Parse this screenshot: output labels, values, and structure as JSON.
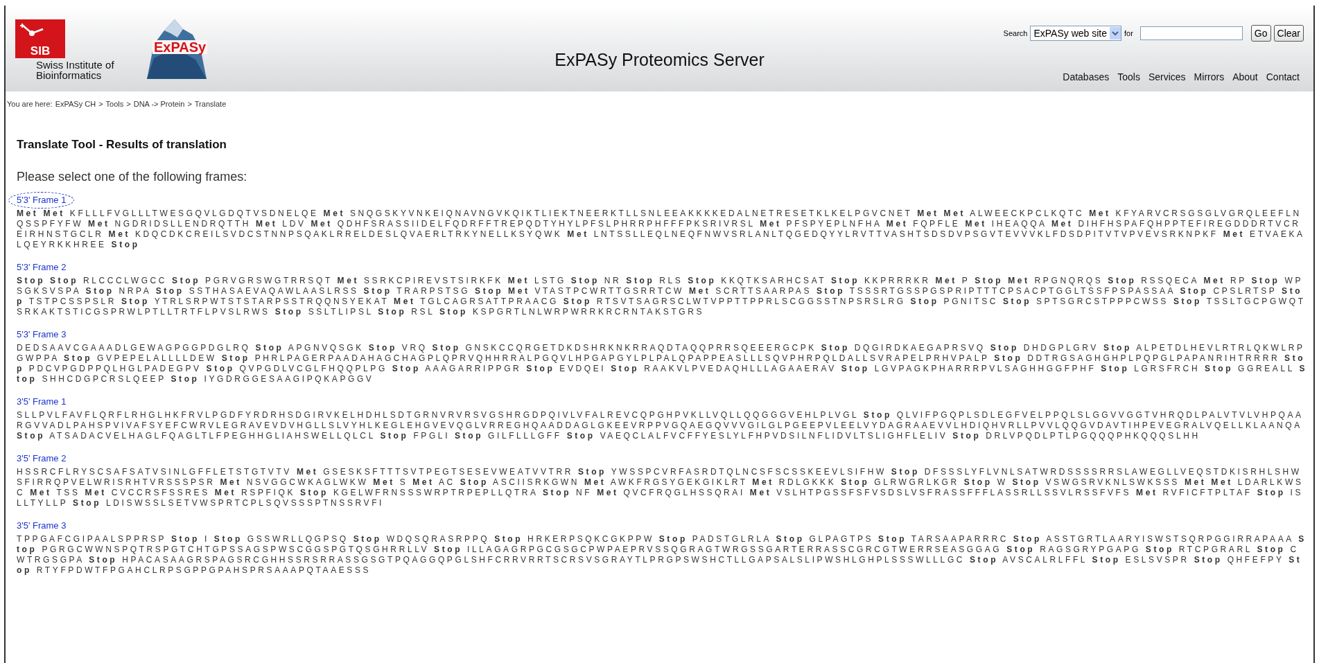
{
  "header": {
    "sib_logo_text": "SIB",
    "institute_name": "Swiss Institute of Bioinformatics",
    "expasy_logo_text": "ExPASy",
    "title": "ExPASy Proteomics Server",
    "search": {
      "label": "Search",
      "scope": "ExPASy web site",
      "for_label": "for",
      "buttons": [
        "Go",
        "Clear"
      ]
    },
    "nav": [
      "Databases",
      "Tools",
      "Services",
      "Mirrors",
      "About",
      "Contact"
    ]
  },
  "breadcrumb": {
    "prefix": "You are here:",
    "separator": ">",
    "items": [
      "ExPASy CH",
      "Tools",
      "DNA -> Protein",
      "Translate"
    ]
  },
  "heading": "Translate Tool - Results of translation",
  "instruction": "Please select one of the following frames:",
  "frames": [
    {
      "title": "5'3' Frame 1",
      "highlighted": true,
      "sequence": "**Met** **Met** KFLLLFVGLLLTWESGQVLGDQTVSDNELQE **Met** SNQGSKYVNKEIQNAVNGVKQIKTLIEKTNEERKTLLSNLEEAKKKKEDALNETRESETKLKELPGVCNET **Met** **Met** ALWEECKPCLKQTC **Met** KFYARVCRSGSGLVGRQLEEFLNQSSPFYFW **Met** NGDRIDSLLENDRQTTH **Met** LDV **Met** QDHFSRASSIIDELFQDRFFTREPQDTYHYLPFSLPHRRPHFFFPKSRIVRSL **Met** PFSPYEPLNFHA **Met** FQPFLE **Met** IHEAQQA **Met** DIHFHSPAFQHPPTEFIREGDDDRTVCREIRHNSTGCLR **Met** KDQCDKCREILSVDCSTNNPSQAKLRRELDESLQVAERLTRKYNELLKSYQWK **Met** LNTSSLLEQLNEQFNWVSRLANLTQGEDQYYLRVTTVASHTSDSDVPSGVTEVVVKLFDSDPITVTVPVEVSRKNPKF **Met** ETVAEKALQEYRKKHREE **Stop**"
    },
    {
      "title": "5'3' Frame 2",
      "highlighted": false,
      "sequence": "**Stop** **Stop** RLCCCLWGCC **Stop** PGRVGRSWGTRRSQT **Met** SSRKCPIREVSTSIRKFK **Met** LSTG **Stop** NR **Stop** RLS **Stop** KKQTKSARHCSAT **Stop** KKPRRRKR **Met** P **Stop** **Met** RPGNQRQS **Stop** RSSQECA **Met** RP **Stop** WPSGKSVSPA **Stop** NRPA **Stop** SSTHASAEVAQAWLAASLRSS **Stop** TRARPSTSG **Stop** **Met** VTASTPCWRTTGSRRTCW **Met** SCRTTSAARPAS **Stop** TSSSRTGSSPGSPRIPTTTCPSACPTGGLTSSFPSPASSAA **Stop** CPSLRTSP **Stop** TSTPCSSPSLR **Stop** YTRLSRPWTSTSTARPSSTRQQNSYEKAT **Met** TGLCAGRSATTPRAACG **Stop** RTSVTSAGRSCLWTVPPTTPPRLSCGGSSTNPSRSLRG **Stop** PGNITSC **Stop** SPTSGRCSTPPPCWSS **Stop** TSSLTGCPGWQTSRKAKTSTICGSPRWLPTLLTRTFLPVSLRWS **Stop** SSLTLIPSL **Stop** RSL **Stop** KSPGRTLNLWRPWRRKRCRNTAKSTGRS"
    },
    {
      "title": "5'3' Frame 3",
      "highlighted": false,
      "sequence": "DEDSAAVCGAAADLGEWAGPGGPDGLRQ **Stop** APGNVQSGK **Stop** VRQ **Stop** GNSKCCQRGETDKDSHRKNKRRAQDTAQQPRRSQEEERGCPK **Stop** DQGIRDKAEGAPRSVQ **Stop** DHDGPLGRV **Stop** ALPETDLHEVLRTRLQKWLRPGWPPA **Stop** GVPEPELALLLLDEW **Stop** PHRLPAGERPAADAHAGCHAGPLQPRVQHHRRALPGQVLHPGAPGYLPLPALQPAPPEASLLLSQVPHRPQLDALLSVRAPELPRHVPALP **Stop** DDTRGSAGHGHPLPQPGLPAPANRIHTRRRR **Stop** PDCVPGDPPQLHGLPADEGPV **Stop** QVPGDLVCGLFHQQPLPG **Stop** AAAGARRIPPGR **Stop** EVDQEI **Stop** RAAKVLPVEDAQHLLLAGAAERAV **Stop** LGVPAGKPHARRRPVLSAGHHGGFPHF **Stop** LGRSFRCH **Stop** GGREALL **Stop** SHHCDGPCRSLQEEP **Stop** IYGDRGGESAAGIPQKAPGGV"
    },
    {
      "title": "3'5' Frame 1",
      "highlighted": false,
      "sequence": "SLLPVLFAVFLQRFLRHGLHKFRVLPGDFYRDRHSDGIRVKELHDHLSDTGRNVRVRSVGSHRGDPQIVLVFALREVCQPGHPVKLLVQLLQQGGGVEHLPLVGL **Stop** QLVIFPGQPLSDLEGFVELPPQLSLGGVVGGTVHRQDLPALVTVLVHPQAARGVVADLPAHSPVIVAFSYEFCWRVLEGRAVEVDVHGLLSLVYHLKEGLEHGVEVQGLVRREGHQAADDAGLGKEEVRPPVGQAEGQVVVGILGLPGEEPVLEELVYDAGRAAEVVLHDIQHVRLLPVVLQQGVDAVTIHPEVEGRALVQELLKLAANQA **Stop** ATSADACVELHAGLFQAGLTLFPEGHHGLIAHSWELLQLCL **Stop** FPGLI **Stop** GILFLLLGFF **Stop** VAEQCLALFVCFFYESLYLFHPVDSILNFLIDVLTSLIGHFLELIV **Stop** DRLVPQDLPTLPGQQQPHKQQQSLHH"
    },
    {
      "title": "3'5' Frame 2",
      "highlighted": false,
      "sequence": "HSSRCFLRYSCSAFSATVSINLGFFLETSTGTVTV **Met** GSESKSFTTTSVTPEGTSESEVWEATVVTRR **Stop** YWSSPCVRFASRDTQLNCSFSCSSKEEVLSIFHW **Stop** DFSSSLYFLVNLSATWRDSSSSRRSLAWEGLLVEQSTDKISRHLSHWSFIRRQPVELWRISRHTVRSSSPSR **Met** NSVGGCWKAGLWKW **Met** S **Met** AC **Stop** ASCIISRKGWN **Met** AWKFRGSYGEKGIKLRT **Met** RDLGKKK **Stop** GLRWGRLKGR **Stop** W **Stop** VSWGSRVKNLSWKSSS **Met** **Met** LDARLKWSC **Met** TSS **Met** CVCCRSFSSRES **Met** RSPFIQK **Stop** KGELWFRNSSSWRPTRPEPLLQTRA **Stop** NF **Met** QVCFRQGLHSSQRAI **Met** VSLHTPGSSFSFVSDSLVSFRASSFFFLASSRLLSSVLRSSFVFS **Met** RVFICFTPLTAF **Stop** ISLLTYLLP **Stop** LDISWSSLSETVWSPRTCPLSQVSSSPTNSSRVFI"
    },
    {
      "title": "3'5' Frame 3",
      "highlighted": false,
      "sequence": "TPPGAFCGIPAALSPPRSP **Stop** I **Stop** GSSWRLLQGPSQ **Stop** WDQSQRASRPPQ **Stop** HRKERPSQKCGKPPW **Stop** PADSTGLRLA **Stop** GLPAGTPS **Stop** TARSAAPARRRC **Stop** ASSTGRTLAARYISWSTSQRPGGIRRAPAAA **Stop** PGRGCWWNSPQTRSPGTCHTGPSSAGSPWSCGGSPGTQSGHRRLLV **Stop** ILLAGAGRPGCGSGCPWPAEPRVSSQGRAGTWRGSSGARTERRASSCGRCGTWERRSEASGGAG **Stop** RAGSGRYPGAPG **Stop** RTCPGRARL **Stop** CWTRGSGPA **Stop** HPACASAAGRSPAGSRCGHHSSRSRRASSGSGTPQAGGQPGLSHFCRRVRRTSCRSVSGRAYTLPRGPSWSHCTLLGAPSALSLIPWSHLGHPLSSSWLLLGC **Stop** AVSCALRLFFL **Stop** ESLSVSPR **Stop** QHFEFPY **Stop** RTYFPDWTFPGAHCLRPSGPPGPAHSPRSAAAPQTAAESSS"
    }
  ]
}
